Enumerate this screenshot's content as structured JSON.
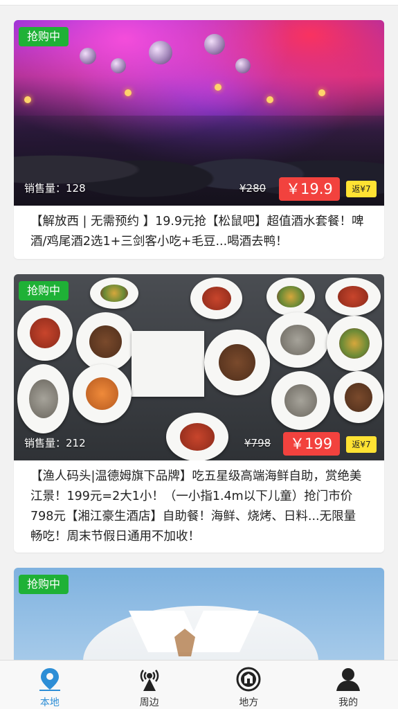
{
  "colors": {
    "accent": "#2d8ed6",
    "live_badge": "#1fb136",
    "price_bg": "#f2423e",
    "rebate_bg": "#ffe233"
  },
  "deals": [
    {
      "badge": "抢购中",
      "sales": "销售量：128",
      "original_price": "¥280",
      "price": "￥19.9",
      "rebate": "返¥7",
      "description": "【解放西 | 无需预约 】19.9元抢【松鼠吧】超值酒水套餐！啤酒/鸡尾酒2选1+三剑客小吃+毛豆...喝酒去鸭！"
    },
    {
      "badge": "抢购中",
      "sales": "销售量：212",
      "original_price": "¥798",
      "price": "￥199",
      "rebate": "返¥7",
      "description": "【渔人码头|温德姆旗下品牌】吃五星级高端海鲜自助，赏绝美江景！199元=2大1小！（一小指1.4m以下儿童）抢门市价798元【湘江豪生酒店】自助餐！海鲜、烧烤、日料...无限量畅吃！周末节假日通用不加收！"
    },
    {
      "badge": "抢购中"
    }
  ],
  "tabbar": [
    {
      "label": "本地",
      "icon": "location-pin-icon",
      "active": true
    },
    {
      "label": "周边",
      "icon": "radio-tower-icon",
      "active": false
    },
    {
      "label": "地方",
      "icon": "badge-emblem-icon",
      "active": false
    },
    {
      "label": "我的",
      "icon": "user-icon",
      "active": false
    }
  ]
}
